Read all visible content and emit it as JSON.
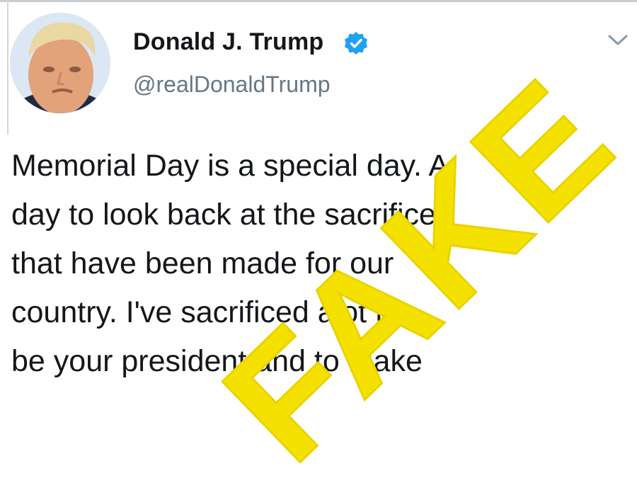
{
  "tweet": {
    "author_name": "Donald J. Trump",
    "handle": "@realDonaldTrump",
    "verified": true,
    "text_lines": [
      "Memorial Day is a special day. A",
      "day to look back at the sacrifices",
      "that have been made for our",
      "country. I've sacrificed alot to",
      "be your president and to Make"
    ]
  },
  "icons": {
    "avatar": "profile-photo",
    "verified": "verified-badge-icon",
    "menu": "chevron-down-icon"
  },
  "overlay": {
    "watermark": "FAKE",
    "watermark_color": "#f5e100"
  },
  "colors": {
    "name": "#14171a",
    "handle": "#657786",
    "verified_blue": "#1da1f2"
  }
}
